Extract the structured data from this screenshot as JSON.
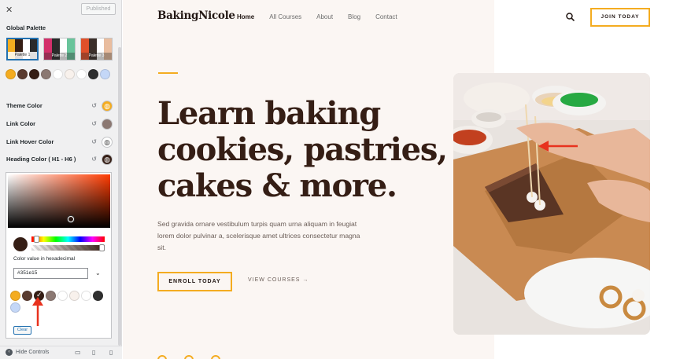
{
  "panel": {
    "close_glyph": "✕",
    "published_label": "Published",
    "global_palette_title": "Global Palette",
    "palettes": [
      {
        "label": "Palette 1",
        "colors": [
          "#f4ac20",
          "#351e15",
          "#ffffff",
          "#2a2a2a"
        ]
      },
      {
        "label": "Palette 2",
        "colors": [
          "#d3306b",
          "#2b2b2b",
          "#ffffff",
          "#69c49b"
        ]
      },
      {
        "label": "Palette 3",
        "colors": [
          "#e0502a",
          "#3b2f2a",
          "#ffffff",
          "#e9bd9f"
        ]
      }
    ],
    "swatches": [
      "#f4ac20",
      "#5a3b2f",
      "#351e15",
      "#8b7872",
      "#ffffff",
      "#f8f1ec",
      "#ffffff",
      "#2f2f2f",
      "#c4d7f7"
    ],
    "color_settings": [
      {
        "label": "Theme Color",
        "color": "#f4ac20",
        "icon": "globe-icon"
      },
      {
        "label": "Link Color",
        "color": "#8b7872",
        "icon": ""
      },
      {
        "label": "Link Hover Color",
        "color": "#ffffff",
        "icon": "globe-icon"
      },
      {
        "label": "Heading Color ( H1 - H6 )",
        "color": "#351e15",
        "icon": "globe-icon"
      }
    ],
    "reset_glyph": "↺",
    "picker": {
      "hex_label": "Color value in hexadecimal",
      "hex_value": "#351e15",
      "selected_index": 2,
      "clear_label": "Clear"
    },
    "hide_controls_label": "Hide Controls"
  },
  "site": {
    "logo": "BakingNicole",
    "nav": [
      "Home",
      "All Courses",
      "About",
      "Blog",
      "Contact"
    ],
    "join_label": "JOIN TODAY",
    "hero_lines": [
      "Learn baking",
      "cookies, pastries,",
      "cakes & more."
    ],
    "paragraph": "Sed gravida ornare vestibulum turpis quam urna aliquam in feugiat lorem dolor pulvinar a, scelerisque amet ultrices consectetur magna sit.",
    "enroll_label": "ENROLL TODAY",
    "view_label": "VIEW COURSES →"
  },
  "colors": {
    "accent": "#f4ac20",
    "heading": "#351e15",
    "annotation_arrow": "#e8321e"
  }
}
